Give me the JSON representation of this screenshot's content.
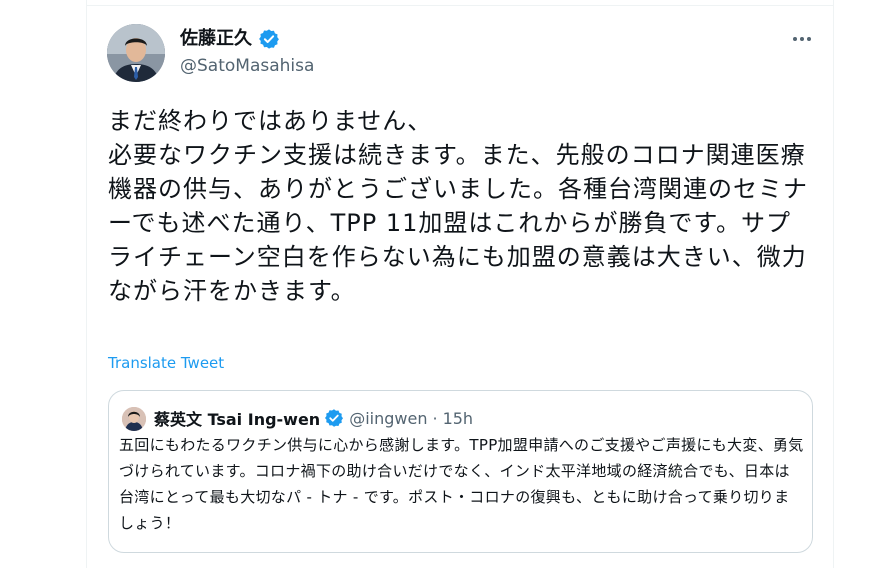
{
  "tweet": {
    "author_name": "佐藤正久",
    "author_handle": "@SatoMasahisa",
    "text": "まだ終わりではありません、\n必要なワクチン支援は続きます。また、先般のコロナ関連医療機器の供与、ありがとうございました。各種台湾関連のセミナーでも述べた通り、TPP 11加盟はこれからが勝負です。サプライチェーン空白を作らない為にも加盟の意義は大きい、微力ながら汗をかきます。",
    "translate_label": "Translate Tweet"
  },
  "quoted_tweet": {
    "author_name": "蔡英文 Tsai Ing-wen",
    "author_handle": "@iingwen",
    "separator": "·",
    "time": "15h",
    "text": "五回にもわたるワクチン供与に心から感謝します。TPP加盟申請へのご支援やご声援にも大変、勇気づけられています。コロナ禍下の助け合いだけでなく、インド太平洋地域の経済統合でも、日本は台湾にとって最も大切なパ - トナ - です。ポスト・コロナの復興も、ともに助け合って乗り切りましょう！"
  },
  "colors": {
    "accent": "#1d9bf0",
    "secondary_text": "#536471",
    "border": "#cfd9de"
  },
  "icons": {
    "verified": "verified-badge-icon",
    "more": "more-options-icon"
  }
}
